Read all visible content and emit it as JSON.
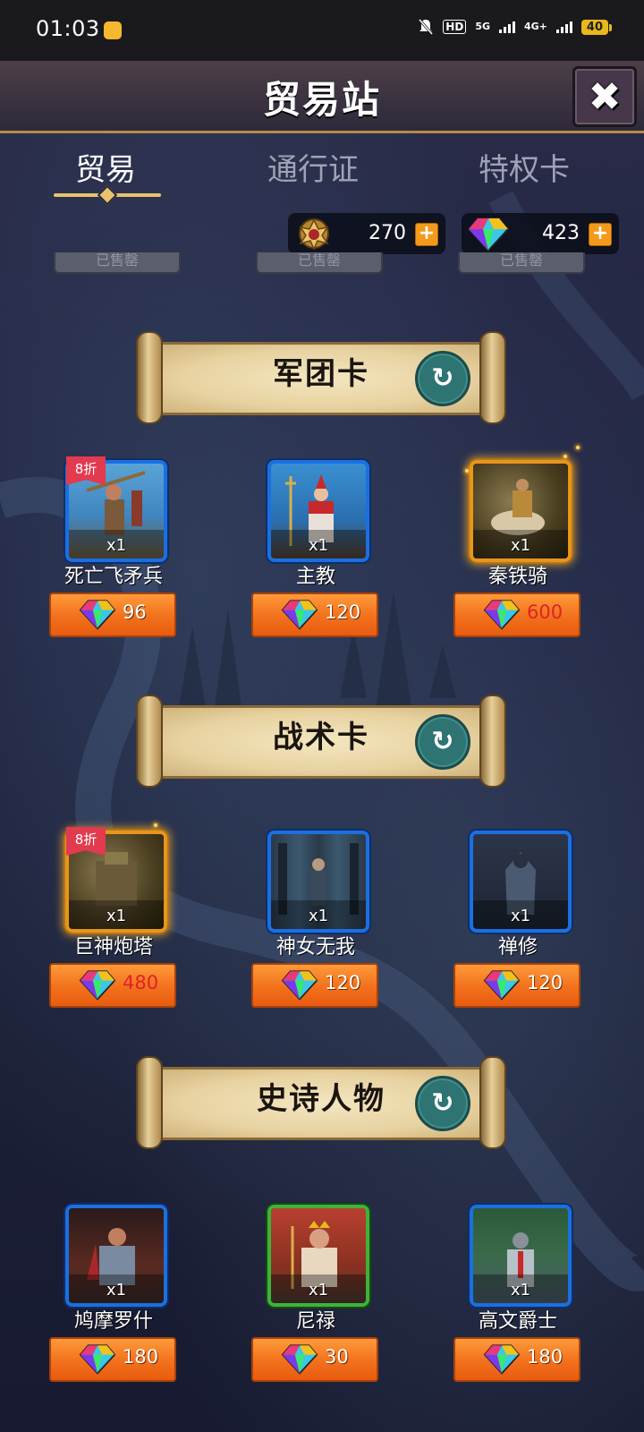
{
  "status_bar": {
    "time": "01:03",
    "network_hd": "HD",
    "network_1": "5G",
    "network_2": "4G+",
    "battery": "40"
  },
  "header": {
    "title": "贸易站"
  },
  "tabs": [
    {
      "label": "贸易",
      "active": true
    },
    {
      "label": "通行证",
      "active": false
    },
    {
      "label": "特权卡",
      "active": false
    }
  ],
  "currencies": [
    {
      "icon": "emblem-icon",
      "value": "270"
    },
    {
      "icon": "gem-icon",
      "value": "423"
    }
  ],
  "partial_buttons": [
    "已售罄",
    "已售罄",
    "已售罄"
  ],
  "sections": [
    {
      "title": "军团卡",
      "cards": [
        {
          "name": "死亡飞矛兵",
          "qty": "x1",
          "price": "96",
          "discount": "8折",
          "rarity": "blue",
          "price_color": "white"
        },
        {
          "name": "主教",
          "qty": "x1",
          "price": "120",
          "discount": "",
          "rarity": "blue",
          "price_color": "white"
        },
        {
          "name": "秦铁骑",
          "qty": "x1",
          "price": "600",
          "discount": "",
          "rarity": "gold",
          "price_color": "red"
        }
      ]
    },
    {
      "title": "战术卡",
      "cards": [
        {
          "name": "巨神炮塔",
          "qty": "x1",
          "price": "480",
          "discount": "8折",
          "rarity": "gold",
          "price_color": "red"
        },
        {
          "name": "神女无我",
          "qty": "x1",
          "price": "120",
          "discount": "",
          "rarity": "blue",
          "price_color": "white"
        },
        {
          "name": "禅修",
          "qty": "x1",
          "price": "120",
          "discount": "",
          "rarity": "blue",
          "price_color": "white"
        }
      ]
    },
    {
      "title": "史诗人物",
      "cards": [
        {
          "name": "鸠摩罗什",
          "qty": "x1",
          "price": "180",
          "discount": "",
          "rarity": "blue",
          "price_color": "white"
        },
        {
          "name": "尼禄",
          "qty": "x1",
          "price": "30",
          "discount": "",
          "rarity": "green",
          "price_color": "white"
        },
        {
          "name": "高文爵士",
          "qty": "x1",
          "price": "180",
          "discount": "",
          "rarity": "blue",
          "price_color": "white"
        }
      ]
    }
  ],
  "colors": {
    "accent_gold": "#e8c46a",
    "price_orange": "#f2701c",
    "rarity_blue": "#1c6fe0",
    "rarity_gold": "#e8951c",
    "rarity_green": "#3fb23a",
    "refresh_teal": "#2d7472",
    "discount_red": "#e23a4e"
  }
}
